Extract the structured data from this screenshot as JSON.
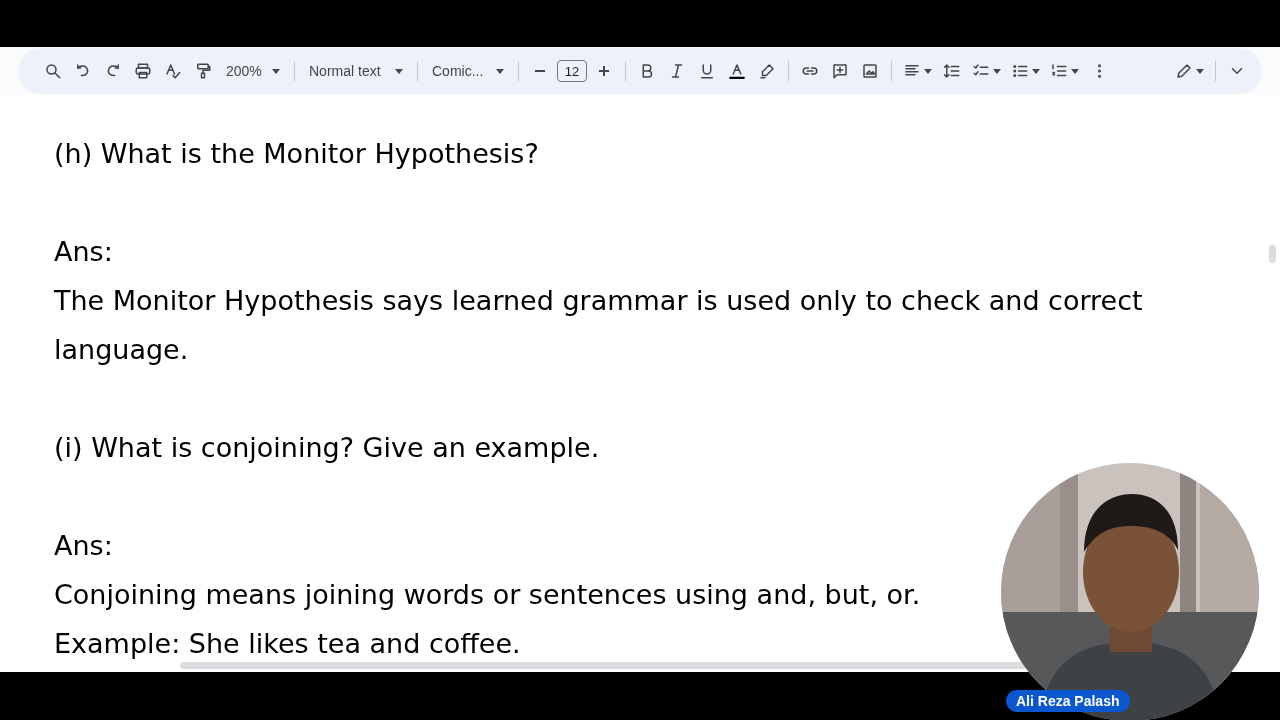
{
  "toolbar": {
    "zoom": "200%",
    "paragraph_style": "Normal text",
    "font": "Comic...",
    "font_size": "12"
  },
  "document": {
    "paragraphs": [
      {
        "kind": "heading",
        "text": "(h) What is the Monitor Hypothesis?"
      },
      {
        "kind": "blank"
      },
      {
        "kind": "text",
        "text": "Ans:"
      },
      {
        "kind": "text",
        "text": "The Monitor Hypothesis says learned grammar is used only to check and correct language."
      },
      {
        "kind": "blank"
      },
      {
        "kind": "heading",
        "text": "(i) What is conjoining? Give an example."
      },
      {
        "kind": "blank"
      },
      {
        "kind": "text",
        "text": "Ans:"
      },
      {
        "kind": "text",
        "text": "Conjoining means joining words or sentences using and, but, or."
      },
      {
        "kind": "text",
        "text": "Example: She likes tea and coffee."
      }
    ]
  },
  "webcam": {
    "kind": "picture",
    "name_tag": "Ali Reza Palash"
  }
}
